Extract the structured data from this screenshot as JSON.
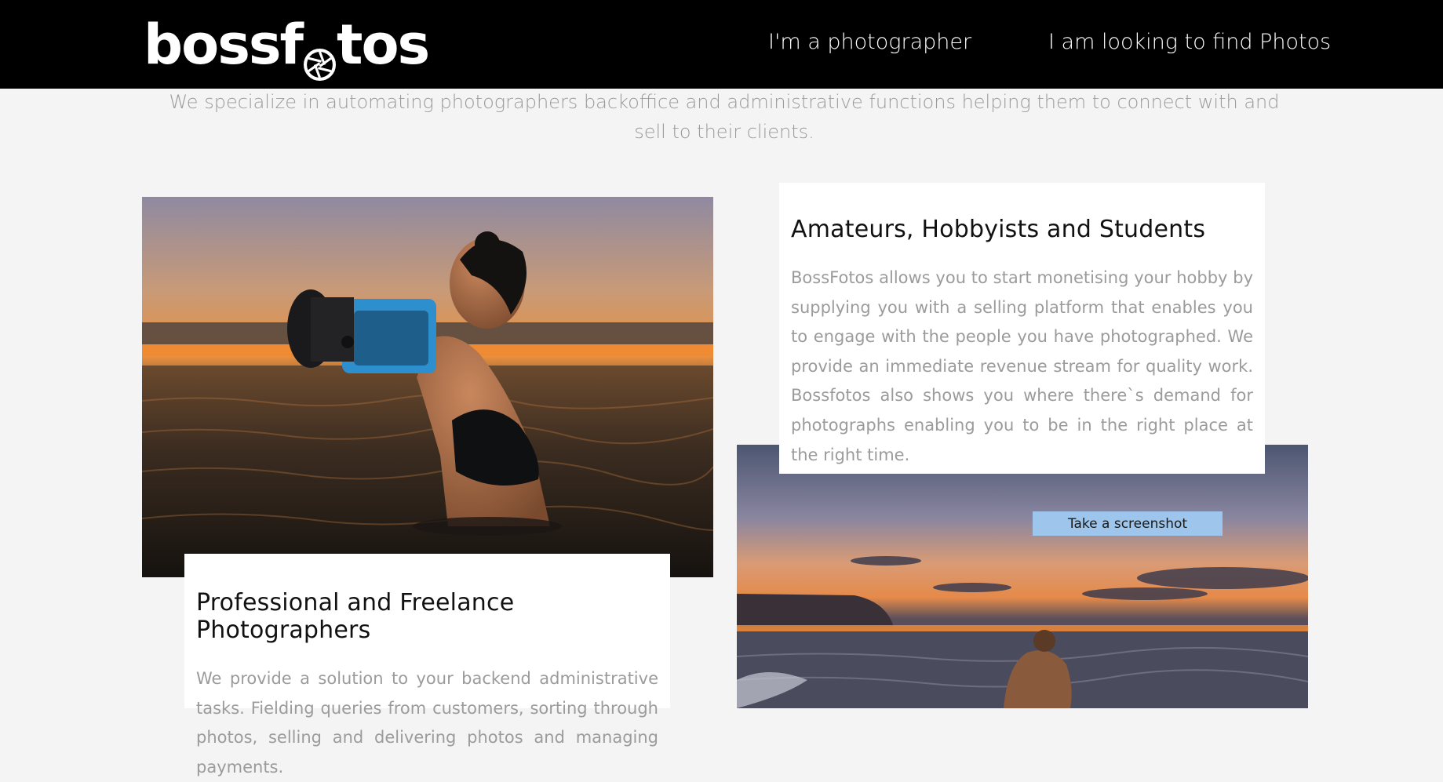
{
  "header": {
    "logo_part1": "bossf",
    "logo_part2": "tos",
    "nav": [
      {
        "label": "I'm a photographer"
      },
      {
        "label": "I am looking to find Photos"
      }
    ]
  },
  "tagline": "We specialize in automating photographers backoffice and administrative functions helping them to connect with and sell to their clients.",
  "cards": {
    "amateurs": {
      "title": "Amateurs, Hobbyists and Students",
      "text": "BossFotos allows you to start monetising your hobby by supplying you with a selling platform that enables you to engage with the people you have photographed. We provide an immediate revenue stream for quality work. Bossfotos also shows you where there`s demand for photographs enabling you to be in the right place at the right time."
    },
    "professional": {
      "title": "Professional and Freelance Photographers",
      "text": "We provide a solution to your backend administrative tasks. Fielding queries from customers, sorting through photos, selling and delivering photos and managing payments."
    }
  },
  "screenshot_button": "Take a screenshot",
  "colors": {
    "header_bg": "#000000",
    "page_bg": "#f5f4f4",
    "button_bg": "#9ec5eb",
    "body_text": "#9b9b9b"
  }
}
